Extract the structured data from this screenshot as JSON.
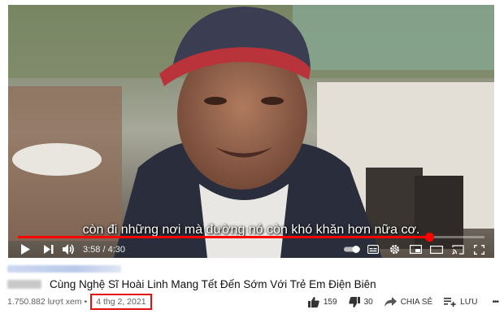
{
  "player": {
    "subtitle": "còn đi những nơi mà đường nó còn khó khăn hơn nữa cơ.",
    "time_display": "3:58 / 4:30",
    "progress": 0.881
  },
  "video": {
    "title": "Cùng Nghệ Sĩ Hoài Linh Mang Tết Đến Sớm Với Trẻ Em Điện Biên",
    "views": "1.750.882 lượt xem",
    "separator": "•",
    "date": "4 thg 2, 2021",
    "likes": "159",
    "dislikes": "30",
    "share_label": "CHIA SẺ",
    "save_label": "LƯU",
    "more_label": "•••"
  },
  "colors": {
    "progress": "#ff0000",
    "highlight_box": "#e01010"
  },
  "icons": [
    "play-icon",
    "next-icon",
    "volume-icon",
    "autoplay-toggle-icon",
    "subtitles-icon",
    "settings-icon",
    "miniplayer-icon",
    "theater-icon",
    "cast-icon",
    "fullscreen-icon",
    "thumbs-up-icon",
    "thumbs-down-icon",
    "share-icon",
    "save-icon",
    "more-icon"
  ]
}
